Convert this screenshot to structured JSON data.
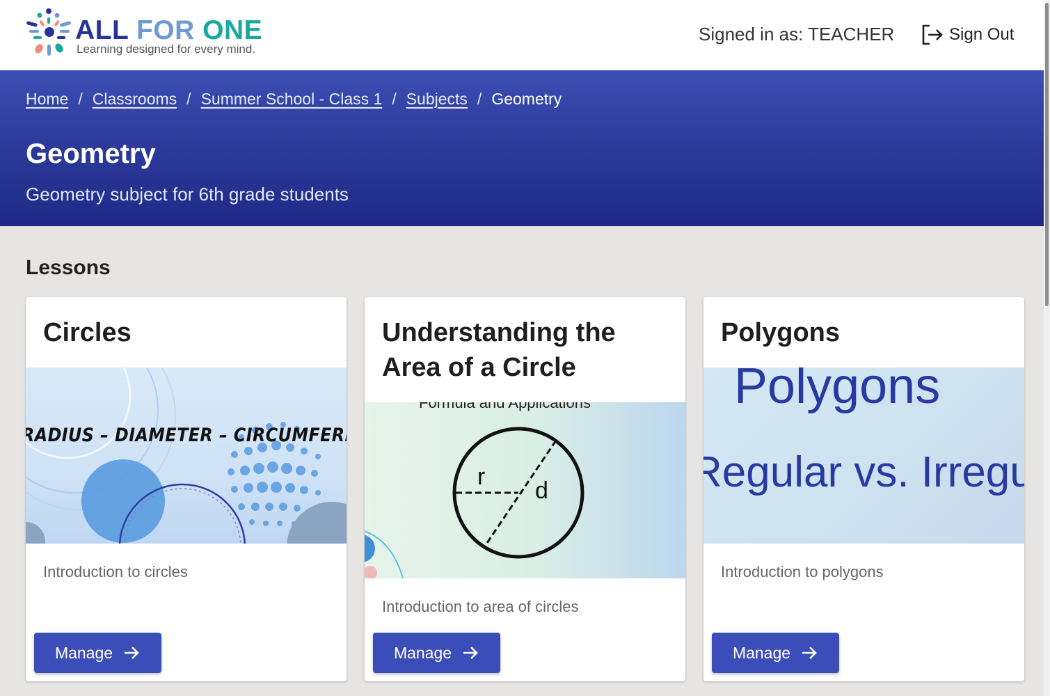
{
  "header": {
    "logo": {
      "word1": "ALL",
      "word2": "FOR",
      "word3": "ONE",
      "tagline": "Learning designed for every mind."
    },
    "signed_in_text": "Signed in as: TEACHER",
    "sign_out_label": "Sign Out",
    "sign_out_icon": "logout-icon"
  },
  "breadcrumb": {
    "items": [
      {
        "label": "Home",
        "link": true
      },
      {
        "label": "Classrooms",
        "link": true
      },
      {
        "label": "Summer School - Class 1",
        "link": true
      },
      {
        "label": "Subjects",
        "link": true
      },
      {
        "label": "Geometry",
        "link": false
      }
    ],
    "separator": "/"
  },
  "hero": {
    "title": "Geometry",
    "subtitle": "Geometry subject for 6th grade students"
  },
  "lessons": {
    "section_title": "Lessons",
    "cards": [
      {
        "title": "Circles",
        "image_text": "RADIUS – DIAMETER – CIRCUMFERENCE",
        "description": "Introduction to circles",
        "button_label": "Manage",
        "button_icon": "arrow-right-icon"
      },
      {
        "title": "Understanding the Area of a Circle",
        "image_text": "Formula and Applications",
        "image_labels": [
          "r",
          "d"
        ],
        "description": "Introduction to area of circles",
        "button_label": "Manage",
        "button_icon": "arrow-right-icon"
      },
      {
        "title": "Polygons",
        "image_text": "Polygons",
        "image_subtext": "Regular vs. Irregular",
        "description": "Introduction to polygons",
        "button_label": "Manage",
        "button_icon": "arrow-right-icon"
      }
    ]
  },
  "colors": {
    "brand_dark": "#27339a",
    "brand_light": "#6f9bd2",
    "brand_teal": "#1aa89e",
    "hero_blue": "#2d3b9c",
    "button_blue": "#3b4db8",
    "page_bg": "#e6e5e3"
  }
}
